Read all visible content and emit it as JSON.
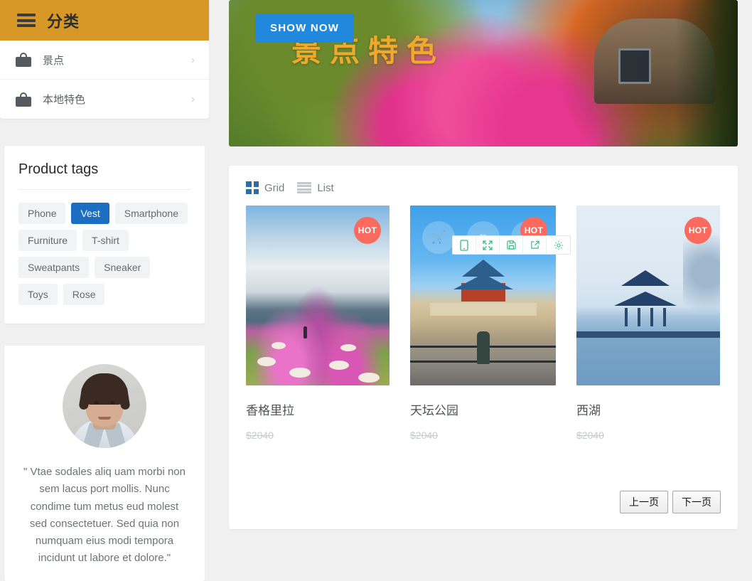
{
  "sidebar": {
    "category": {
      "title": "分类",
      "menu_icon": "hamburger-icon",
      "items": [
        {
          "label": "景点",
          "icon": "shopping-bag-icon",
          "chevron": "›"
        },
        {
          "label": "本地特色",
          "icon": "shopping-bag-icon",
          "chevron": "›"
        }
      ]
    },
    "tags": {
      "title": "Product tags",
      "active": "Vest",
      "items": [
        "Phone",
        "Vest",
        "Smartphone",
        "Furniture",
        "T-shirt",
        "Sweatpants",
        "Sneaker",
        "Toys",
        "Rose"
      ]
    },
    "testimonial": {
      "avatar": "user-avatar",
      "quote": "\" Vtae sodales aliq uam morbi non sem lacus port mollis. Nunc condime tum metus eud molest sed consectetuer. Sed quia non numquam eius modi tempora incidunt ut labore et dolore.\""
    }
  },
  "banner": {
    "button_label": "SHOW NOW",
    "headline": "景点特色",
    "headline_color": "#f0a92c",
    "button_color": "#2089dd"
  },
  "products_panel": {
    "view_modes": [
      {
        "label": "Grid",
        "icon": "grid-icon",
        "active": true
      },
      {
        "label": "List",
        "icon": "list-icon",
        "active": false
      }
    ],
    "float_tools": [
      {
        "name": "mobile-icon",
        "glyph": "▯"
      },
      {
        "name": "expand-icon",
        "glyph": "⤡"
      },
      {
        "name": "save-icon",
        "glyph": "ὋE"
      },
      {
        "name": "share-icon",
        "glyph": "↗"
      },
      {
        "name": "settings-gear-icon",
        "glyph": "⚙"
      }
    ],
    "badge_label": "HOT",
    "hover_actions": [
      {
        "name": "add-to-cart-icon",
        "glyph": "Ὥ2"
      },
      {
        "name": "wishlist-heart-icon",
        "glyph": "♥"
      },
      {
        "name": "quick-view-icon",
        "glyph": "⌕"
      }
    ],
    "items": [
      {
        "name": "香格里拉",
        "price": "$2040",
        "badge": "HOT"
      },
      {
        "name": "天坛公园",
        "price": "$2040",
        "badge": "HOT"
      },
      {
        "name": "西湖",
        "price": "$2040",
        "badge": "HOT"
      }
    ],
    "pagination": {
      "prev": "上一页",
      "next": "下一页"
    }
  },
  "theme": {
    "header_orange": "#d79827",
    "accent_blue": "#1b6ec2",
    "badge_red": "#fb6a5f",
    "tool_green": "#2ebf86",
    "page_bg": "#f0f0f0"
  }
}
